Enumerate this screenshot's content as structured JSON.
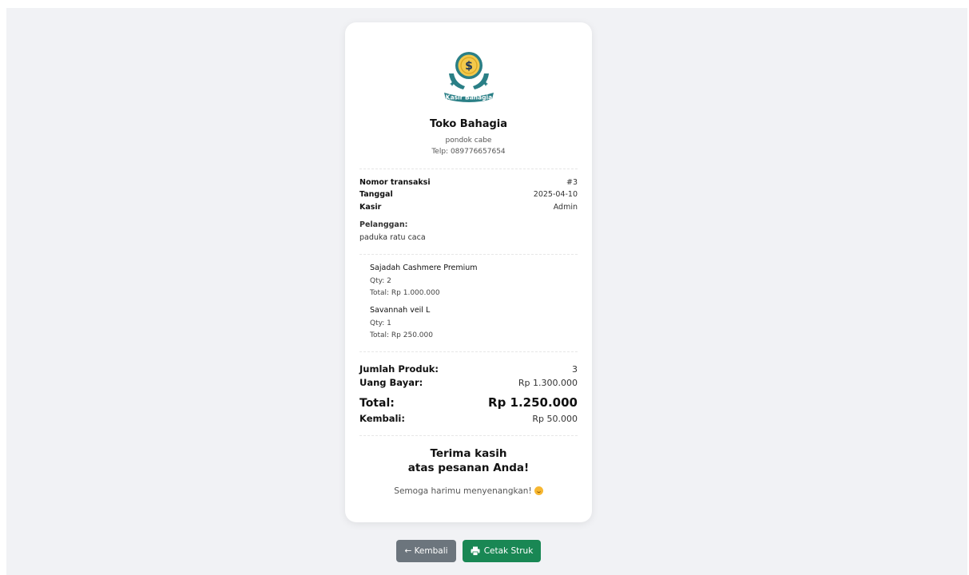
{
  "shop": {
    "logo_text": "Kasir Bahagia",
    "name": "Toko Bahagia",
    "address": "pondok cabe",
    "phone": "Telp: 089776657654"
  },
  "transaction": {
    "number_label": "Nomor transaksi",
    "number_value": "#3",
    "date_label": "Tanggal",
    "date_value": "2025-04-10",
    "cashier_label": "Kasir",
    "cashier_value": "Admin",
    "customer_label": "Pelanggan:",
    "customer_value": "paduka ratu caca"
  },
  "items": [
    {
      "name": "Sajadah Cashmere Premium",
      "qty": "Qty: 2",
      "total": "Total: Rp 1.000.000"
    },
    {
      "name": "Savannah veil L",
      "qty": "Qty: 1",
      "total": "Total: Rp 250.000"
    }
  ],
  "summary": {
    "product_count_label": "Jumlah Produk:",
    "product_count_value": "3",
    "paid_label": "Uang Bayar:",
    "paid_value": "Rp 1.300.000",
    "total_label": "Total:",
    "total_value": "Rp 1.250.000",
    "change_label": "Kembali:",
    "change_value": "Rp 50.000"
  },
  "footer": {
    "thanks_line1": "Terima kasih",
    "thanks_line2": "atas pesanan Anda!",
    "wish": "Semoga harimu menyenangkan!"
  },
  "actions": {
    "back_label": "← Kembali",
    "print_label": "Cetak Struk"
  },
  "colors": {
    "background": "#f1f2f5",
    "back_button": "#6c757d",
    "print_button": "#198754",
    "logo_teal": "#2a7f86",
    "logo_gold": "#f2c94c"
  },
  "icons": {
    "logo": "kasir-bahagia-logo",
    "smile": "smiling-face-icon",
    "print": "printer-icon"
  }
}
